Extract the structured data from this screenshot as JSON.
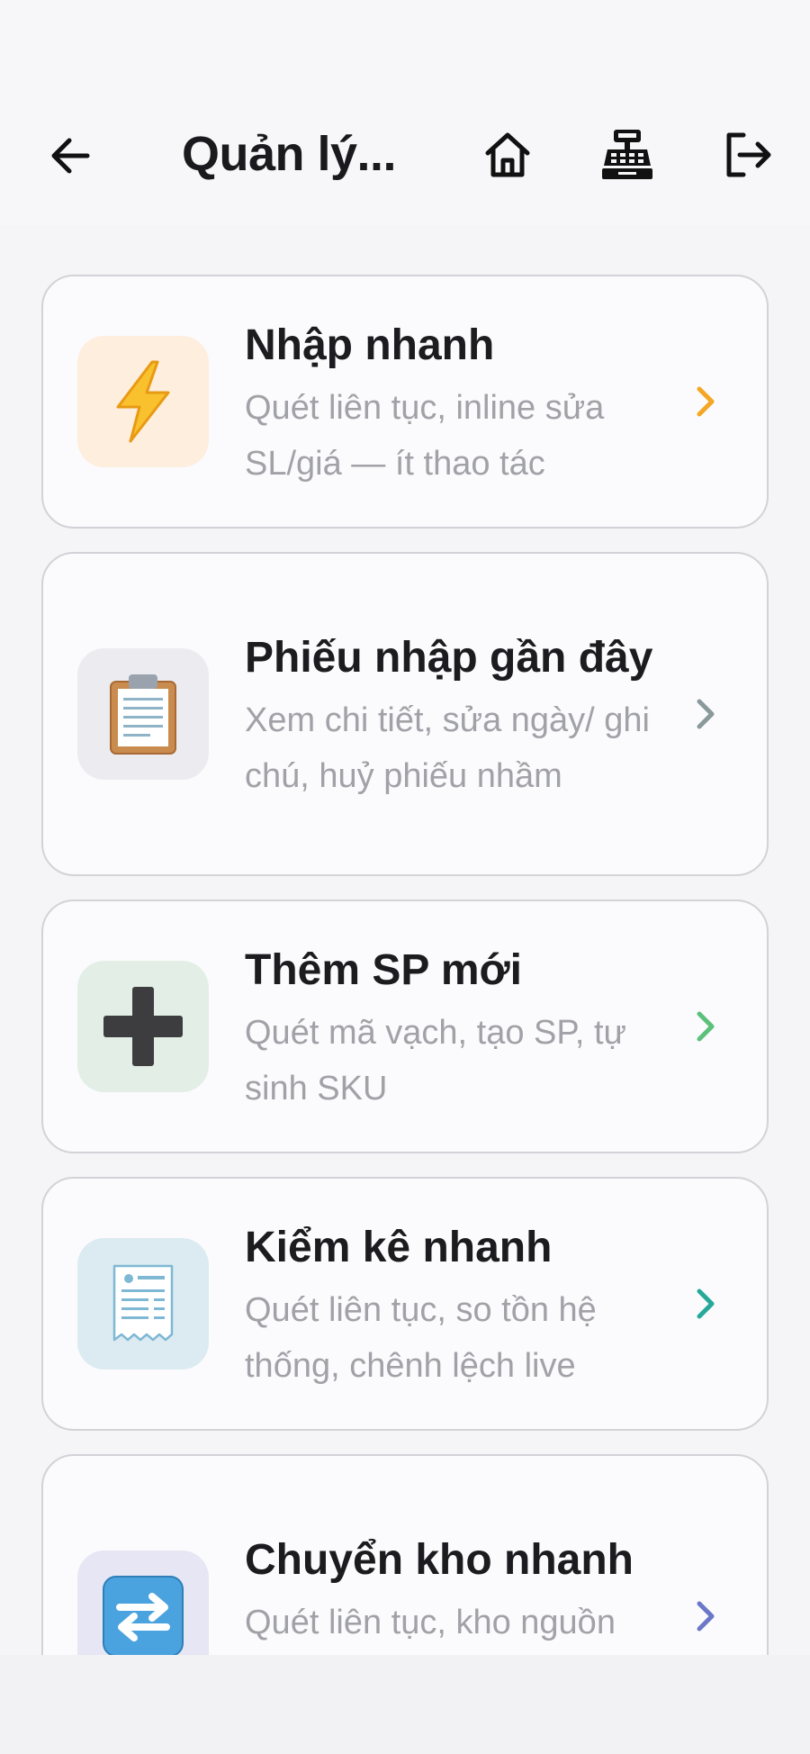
{
  "header": {
    "title": "Quản lý...",
    "icons": [
      "arrow-left-icon",
      "home-icon",
      "cash-register-icon",
      "logout-icon"
    ]
  },
  "cards": [
    {
      "icon": "lightning-icon",
      "icon_bg": "#fdeedd",
      "chevron_color": "#f5a623",
      "title": "Nhập nhanh",
      "desc": "Quét liên tục, inline sửa SL/giá — ít thao tác"
    },
    {
      "icon": "clipboard-icon",
      "icon_bg": "#ececf0",
      "chevron_color": "#8a9a9c",
      "title": "Phiếu nhập gần đây",
      "desc": "Xem chi tiết, sửa ngày/ ghi chú, huỷ phiếu nhầm"
    },
    {
      "icon": "plus-icon",
      "icon_bg": "#e3efe6",
      "chevron_color": "#5cc17a",
      "title": "Thêm SP mới",
      "desc": "Quét mã vạch, tạo SP, tự sinh SKU"
    },
    {
      "icon": "receipt-icon",
      "icon_bg": "#dcebf1",
      "chevron_color": "#27a99a",
      "title": "Kiểm kê nhanh",
      "desc": "Quét liên tục, so tồn hệ thống, chênh lệch live"
    },
    {
      "icon": "arrows-swap-icon",
      "icon_bg": "#e6e6f4",
      "chevron_color": "#6b78c8",
      "title": "Chuyển kho nhanh",
      "desc": "Quét liên tục, kho nguồn mặc định, xem phiếu"
    }
  ]
}
